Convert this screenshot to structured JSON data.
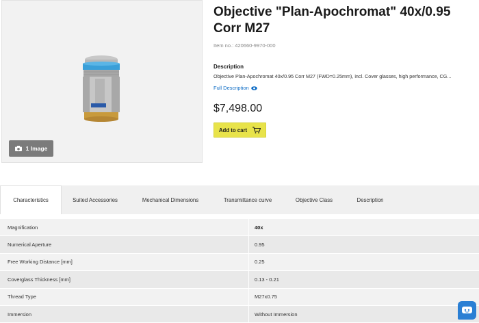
{
  "product": {
    "title": "Objective \"Plan-Apochromat\" 40x/0.95 Corr M27",
    "item_no_label": "Item no.:",
    "item_no": "420660-9970-000",
    "description_heading": "Description",
    "description_text": "Objective Plan-Apochromat 40x/0.95 Corr M27 (FWD=0.25mm), incl. Cover glasses, high performance, CG...",
    "full_description_link": "Full Description",
    "price": "$7,498.00",
    "add_to_cart_label": "Add to cart"
  },
  "image_panel": {
    "image_count_label": "1 Image"
  },
  "tabs": [
    {
      "label": "Characteristics",
      "active": true
    },
    {
      "label": "Suited Accessories",
      "active": false
    },
    {
      "label": "Mechanical Dimensions",
      "active": false
    },
    {
      "label": "Transmittance curve",
      "active": false
    },
    {
      "label": "Objective Class",
      "active": false
    },
    {
      "label": "Description",
      "active": false
    }
  ],
  "characteristics": [
    {
      "label": "Magnification",
      "value": "40x"
    },
    {
      "label": "Numerical Aperture",
      "value": "0.95"
    },
    {
      "label": "Free Working Distance [mm]",
      "value": "0.25"
    },
    {
      "label": "Coverglass Thickness [mm]",
      "value": "0.13 - 0.21"
    },
    {
      "label": "Thread Type",
      "value": "M27x0.75"
    },
    {
      "label": "Immersion",
      "value": "Without Immersion"
    }
  ],
  "icons": {
    "camera": "camera-icon",
    "eye": "eye-icon",
    "cart": "cart-icon",
    "chat": "chat-icon"
  },
  "colors": {
    "add_to_cart_bg": "#e8e34a",
    "link_blue": "#0a6ac4",
    "image_button_bg": "#7b7b7b",
    "chat_widget_bg": "#2a7fd4"
  }
}
